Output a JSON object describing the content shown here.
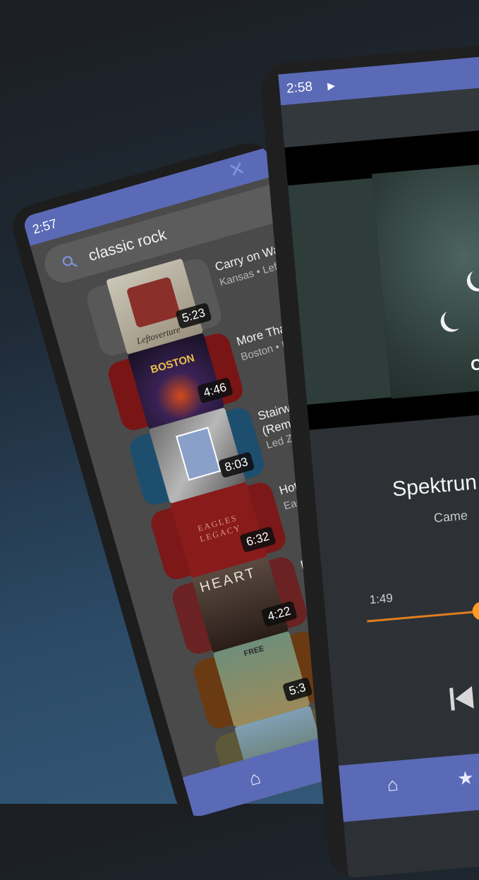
{
  "search_screen": {
    "status_time": "2:57",
    "query": "classic rock",
    "results": [
      {
        "title": "Carry on Wayw",
        "subtitle": "Kansas • Lefto",
        "duration": "5:23",
        "card_color": "#585858",
        "art_color": "#bdb7a8"
      },
      {
        "title": "More Than",
        "subtitle": "Boston • Bo",
        "duration": "4:46",
        "card_color": "#7a1515",
        "art_color": "#2a1b3a"
      },
      {
        "title": "Stairway",
        "title2": "(Remas",
        "subtitle": "Led Zep",
        "duration": "8:03",
        "card_color": "#1e4e6e",
        "art_color": "#9a9a9a"
      },
      {
        "title": "Hote",
        "subtitle": "Eag",
        "duration": "6:32",
        "card_color": "#7c1818",
        "art_color": "#8a1b1b"
      },
      {
        "title": "B",
        "subtitle": "",
        "duration": "4:22",
        "card_color": "#6a2222",
        "art_color": "#3b2c28"
      },
      {
        "title": "",
        "subtitle": "",
        "duration": "5:3",
        "card_color": "#6a3a12",
        "art_color": "#7a7a5a"
      },
      {
        "title": "",
        "subtitle": "",
        "duration": "",
        "card_color": "#5d5838",
        "art_color": "#6a8aa0"
      }
    ],
    "cover_texts": {
      "boston": "BOSTON",
      "eagles": "EAGLES LEGACY",
      "heart": "HEART",
      "free": "FREE",
      "kansas": "Leftoverture"
    },
    "nav": {
      "home_icon": "home-icon",
      "star_icon": "star-icon"
    }
  },
  "player_screen": {
    "status_time": "2:58",
    "track_title": "Spektrun",
    "artist": "Came",
    "elapsed": "1:49",
    "progress": 0.5,
    "cover_text": "CA",
    "accent_color": "#ff9a22",
    "bar_color": "#5b6ab6",
    "nav": {
      "home_icon": "home-icon",
      "star_icon": "star-icon"
    }
  }
}
